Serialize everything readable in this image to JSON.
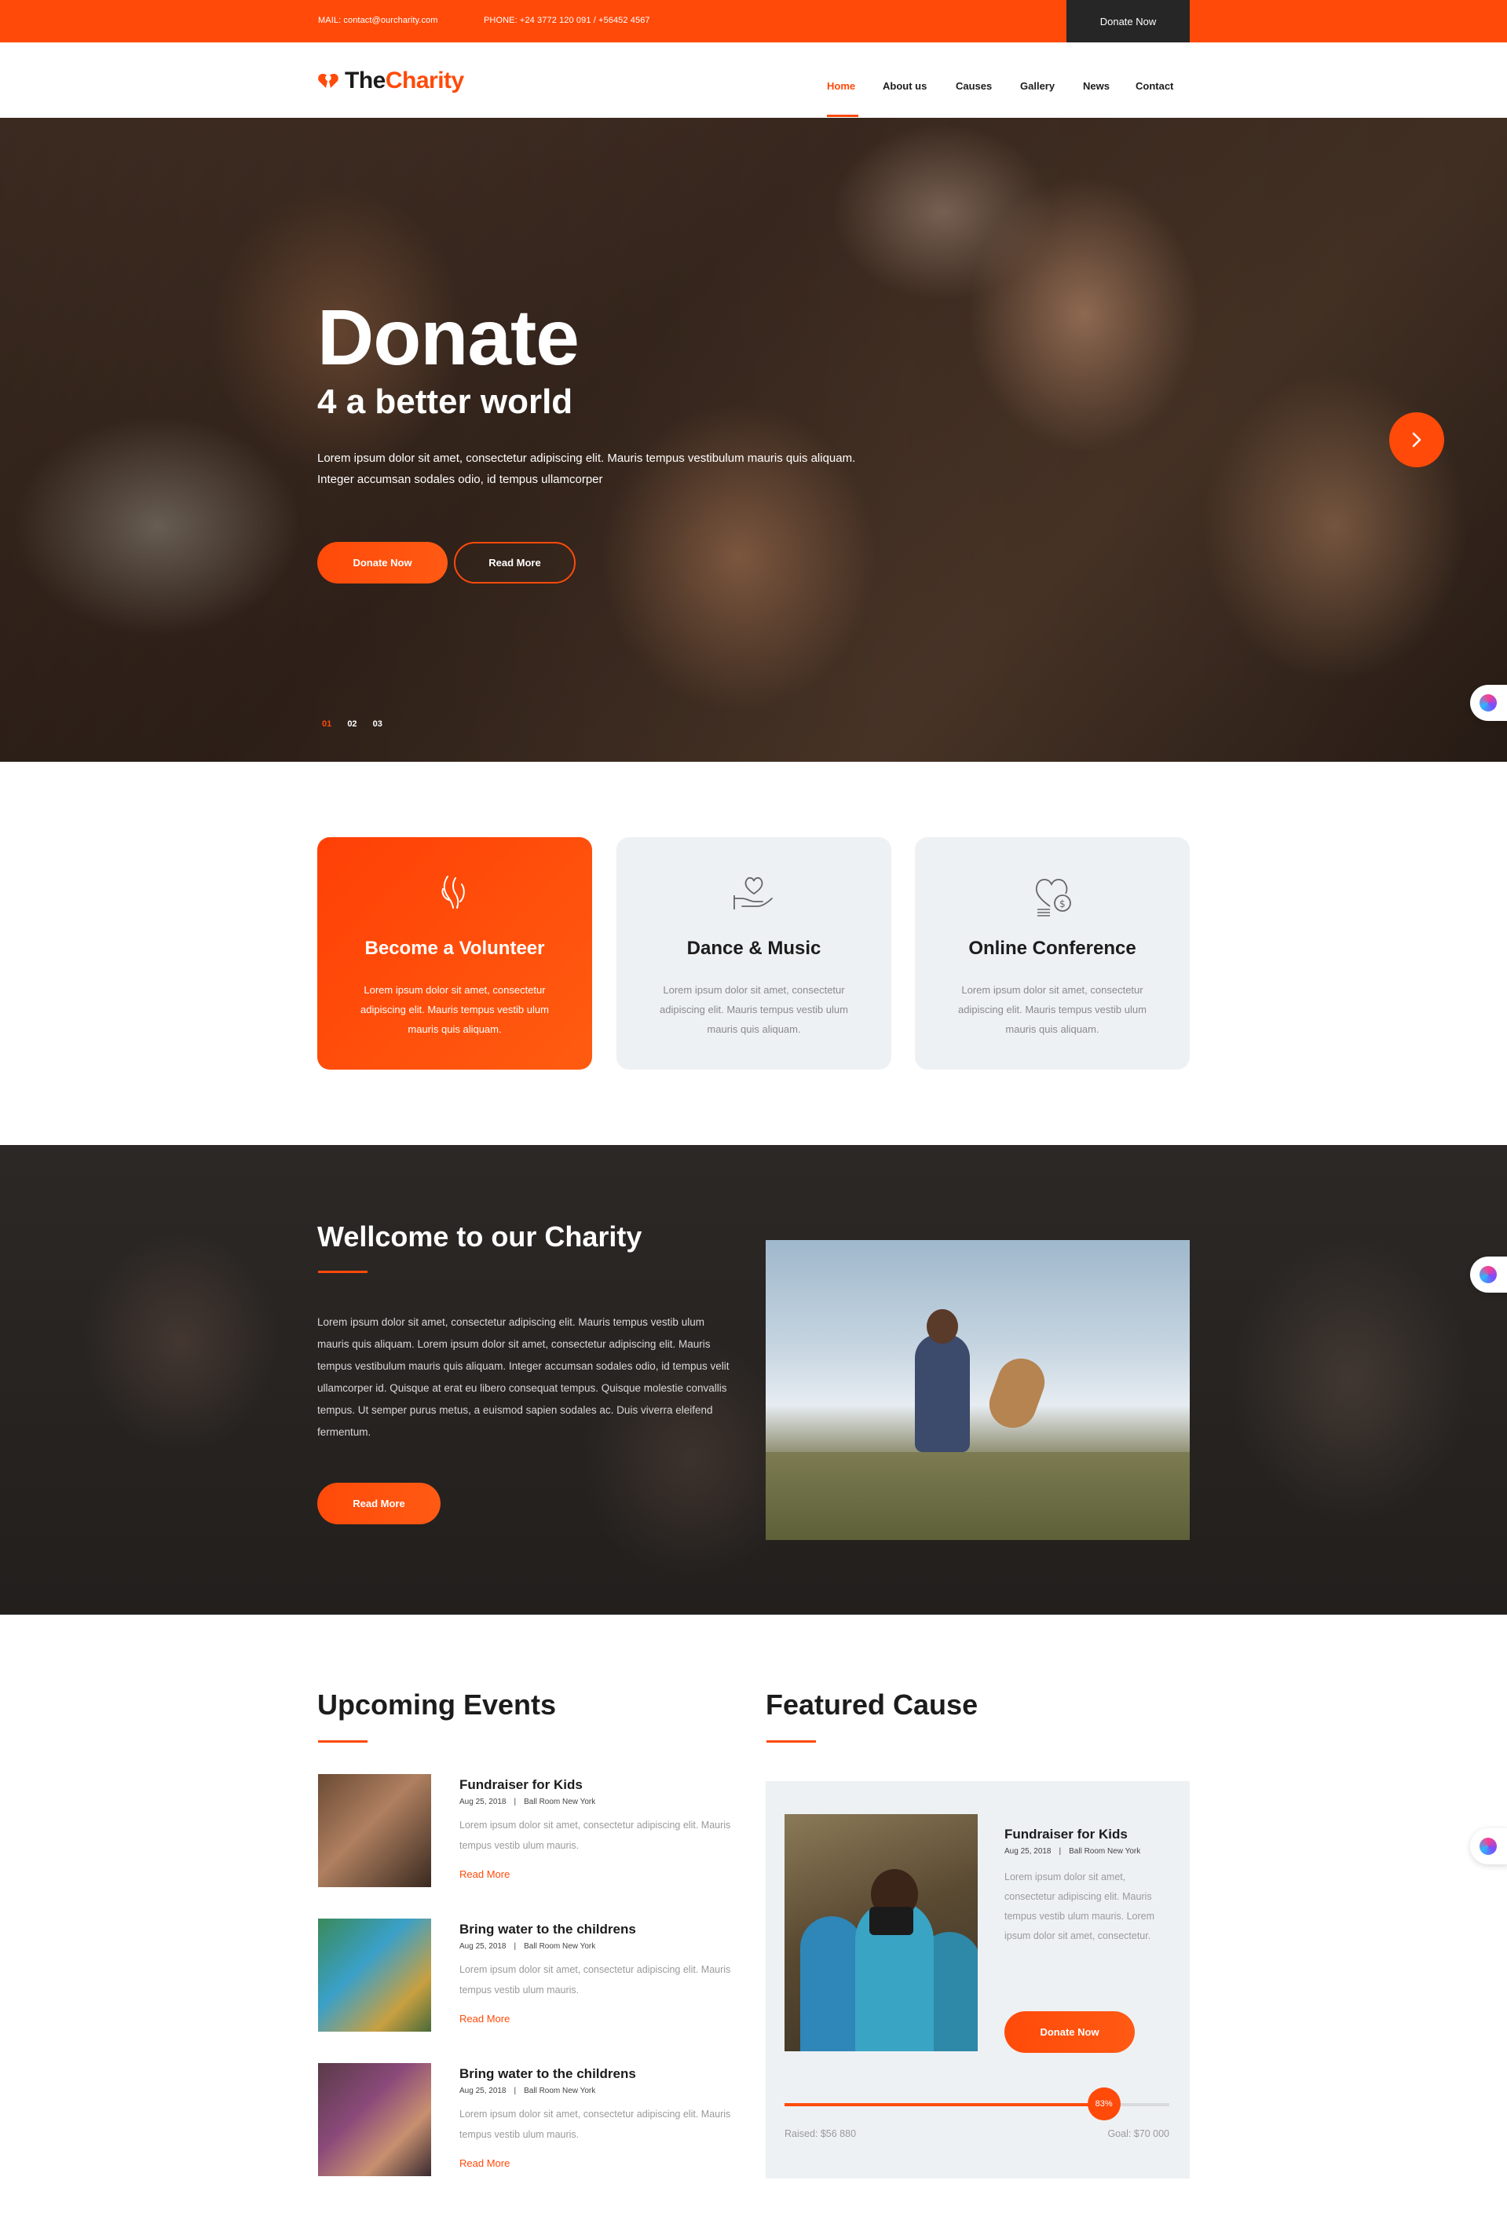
{
  "topbar": {
    "mail": "MAIL: contact@ourcharity.com",
    "phone": "PHONE: +24 3772 120 091 / +56452 4567",
    "donate_label": "Donate Now"
  },
  "header": {
    "logo_the": "The",
    "logo_charity": "Charity",
    "nav": [
      {
        "label": "Home",
        "active": true
      },
      {
        "label": "About us"
      },
      {
        "label": "Causes"
      },
      {
        "label": "Gallery"
      },
      {
        "label": "News"
      },
      {
        "label": "Contact"
      }
    ]
  },
  "hero": {
    "title": "Donate",
    "subtitle": "4 a better world",
    "description": "Lorem ipsum dolor sit amet, consectetur adipiscing elit. Mauris tempus vestibulum mauris quis aliquam. Integer accumsan sodales odio, id tempus ullamcorper",
    "donate_label": "Donate Now",
    "read_more_label": "Read More",
    "slides": [
      "01",
      "02",
      "03"
    ],
    "active_slide": 0
  },
  "features": [
    {
      "title": "Become a Volunteer",
      "text": "Lorem ipsum dolor sit amet, consectetur adipiscing elit. Mauris tempus vestib ulum mauris quis aliquam.",
      "icon": "helping-hands-icon",
      "active": true
    },
    {
      "title": "Dance & Music",
      "text": "Lorem ipsum dolor sit amet, consectetur adipiscing elit. Mauris tempus vestib ulum mauris quis aliquam.",
      "icon": "heart-in-hand-icon"
    },
    {
      "title": "Online Conference",
      "text": "Lorem ipsum dolor sit amet, consectetur adipiscing elit. Mauris tempus vestib ulum mauris quis aliquam.",
      "icon": "heart-coins-icon"
    }
  ],
  "welcome": {
    "title": "Wellcome to our Charity",
    "text": "Lorem ipsum dolor sit amet, consectetur adipiscing elit. Mauris tempus vestib ulum mauris quis aliquam. Lorem ipsum dolor sit amet, consectetur adipiscing elit. Mauris tempus vestibulum mauris quis aliquam. Integer accumsan sodales odio, id tempus velit ullamcorper id. Quisque at erat eu libero consequat tempus. Quisque molestie convallis tempus. Ut semper purus metus, a euismod sapien sodales ac. Duis viverra eleifend fermentum.",
    "read_more_label": "Read More"
  },
  "events": {
    "title": "Upcoming Events",
    "items": [
      {
        "title": "Fundraiser for Kids",
        "date": "Aug 25, 2018",
        "place": "Ball Room New York",
        "text": "Lorem ipsum dolor sit amet, consectetur adipiscing elit. Mauris tempus vestib ulum mauris.",
        "more": "Read More"
      },
      {
        "title": "Bring water to the childrens",
        "date": "Aug 25, 2018",
        "place": "Ball Room New York",
        "text": "Lorem ipsum dolor sit amet, consectetur adipiscing elit. Mauris tempus vestib ulum mauris.",
        "more": "Read More"
      },
      {
        "title": "Bring water to the childrens",
        "date": "Aug 25, 2018",
        "place": "Ball Room New York",
        "text": "Lorem ipsum dolor sit amet, consectetur adipiscing elit. Mauris tempus vestib ulum mauris.",
        "more": "Read More"
      }
    ]
  },
  "cause": {
    "section_title": "Featured Cause",
    "title": "Fundraiser for Kids",
    "date": "Aug 25, 2018",
    "place": "Ball Room New York",
    "text": "Lorem ipsum dolor sit amet, consectetur adipiscing elit. Mauris tempus vestib ulum mauris. Lorem ipsum dolor sit amet, consectetur.",
    "donate_label": "Donate Now",
    "progress_percent": 83,
    "progress_label": "83%",
    "raised": "Raised: $56 880",
    "goal": "Goal: $70 000"
  },
  "colors": {
    "accent": "#ff4a0a",
    "dark": "#262626",
    "card": "#eef1f4"
  }
}
